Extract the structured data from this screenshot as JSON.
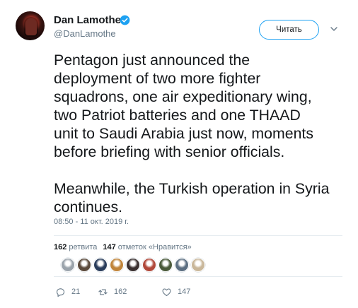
{
  "author": {
    "name": "Dan Lamothe",
    "handle": "@DanLamothe",
    "verified": true
  },
  "follow_button": {
    "label": "Читать"
  },
  "tweet": {
    "text": "Pentagon just announced the\ndeployment of two more fighter\nsquadrons, one air expeditionary wing,\ntwo Patriot batteries and one THAAD\nunit to Saudi Arabia just now, moments\nbefore briefing with senior officials.\n\nMeanwhile, the Turkish operation in Syria\ncontinues.",
    "timestamp": "08:50 - 11 окт. 2019 г."
  },
  "stats": {
    "retweets_count": "162",
    "retweets_label": "ретвита",
    "likes_count": "147",
    "likes_label": "отметок «Нравится»"
  },
  "likers": [
    {
      "color": "#9aa3ab"
    },
    {
      "color": "#5b4a3c"
    },
    {
      "color": "#2a3d5c"
    },
    {
      "color": "#c0843a"
    },
    {
      "color": "#3a3030"
    },
    {
      "color": "#b0483a"
    },
    {
      "color": "#4a5a3a"
    },
    {
      "color": "#5c6f82"
    },
    {
      "color": "#c9b79a"
    }
  ],
  "actions": {
    "reply_count": "21",
    "retweet_count": "162",
    "like_count": "147"
  },
  "colors": {
    "accent": "#1da1f2",
    "text": "#14171a",
    "secondary": "#657786",
    "divider": "#e6ecf0"
  }
}
